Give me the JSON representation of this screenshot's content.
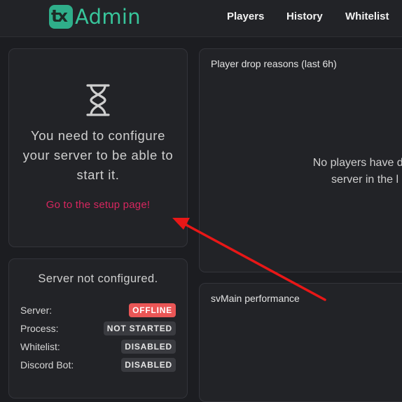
{
  "header": {
    "logo_mark": "tx",
    "logo_text": "Admin",
    "nav": [
      "Players",
      "History",
      "Whitelist"
    ]
  },
  "setup_card": {
    "icon": "hourglass-icon",
    "message": "You need to configure your server to be able to start it.",
    "link": "Go to the setup page!"
  },
  "status_card": {
    "title": "Server not configured.",
    "rows": [
      {
        "label": "Server:",
        "badge": "OFFLINE",
        "color": "red"
      },
      {
        "label": "Process:",
        "badge": "NOT STARTED",
        "color": "gray"
      },
      {
        "label": "Whitelist:",
        "badge": "DISABLED",
        "color": "gray"
      },
      {
        "label": "Discord Bot:",
        "badge": "DISABLED",
        "color": "gray"
      }
    ]
  },
  "drops_card": {
    "title": "Player drop reasons (last 6h)",
    "empty_line1": "No players have disc",
    "empty_line2": "server in the l"
  },
  "perf_card": {
    "title": "svMain performance"
  },
  "colors": {
    "accent": "#38c59b",
    "link": "#d7265f",
    "offline": "#ea5656",
    "annotation_arrow": "#e81717"
  }
}
